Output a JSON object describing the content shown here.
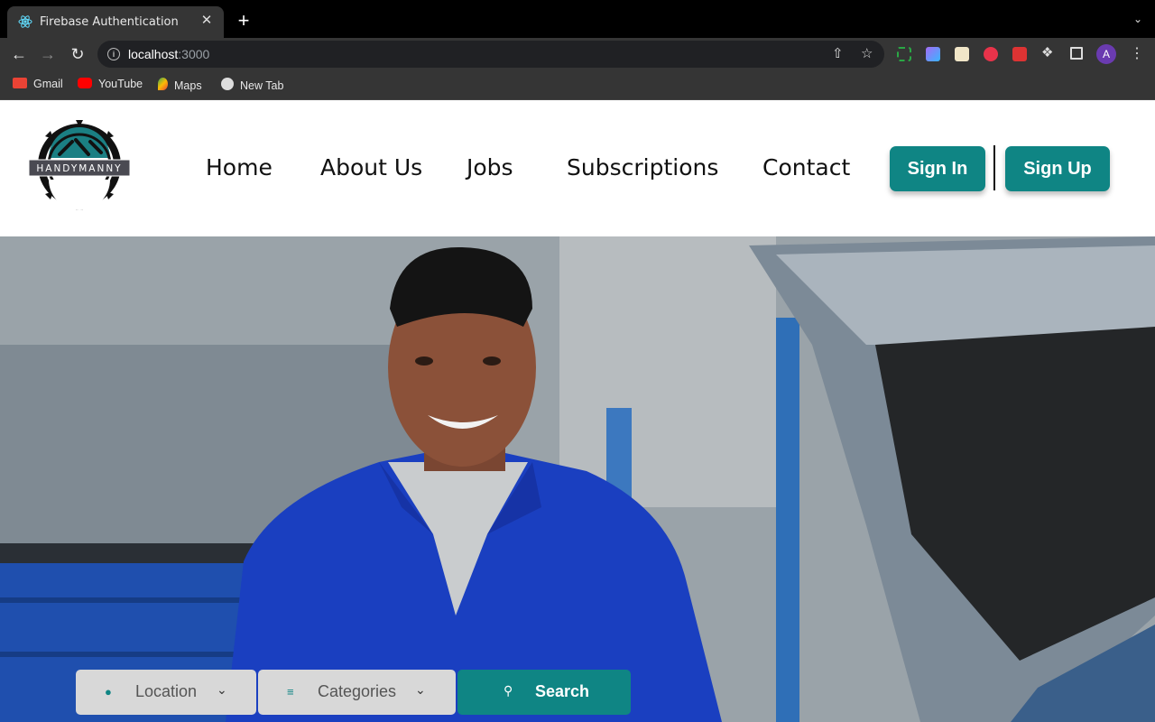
{
  "browser": {
    "tab_title": "Firebase Authentication",
    "tab_close": "✕",
    "new_tab": "+",
    "url_host": "localhost",
    "url_port": ":3000",
    "avatar_letter": "A",
    "bookmarks": [
      {
        "label": "Gmail",
        "icon": "gmail-icon"
      },
      {
        "label": "YouTube",
        "icon": "youtube-icon"
      },
      {
        "label": "Maps",
        "icon": "maps-icon"
      },
      {
        "label": "New Tab",
        "icon": "globe-icon"
      }
    ]
  },
  "site": {
    "logo_text": "HANDYMANNY",
    "nav": [
      "Home",
      "About Us",
      "Jobs",
      "Subscriptions",
      "Contact"
    ],
    "signin_label": "Sign In",
    "signup_label": "Sign Up",
    "accent_color": "#0f8584"
  },
  "search": {
    "location_label": "Location",
    "categories_label": "Categories",
    "search_label": "Search"
  }
}
